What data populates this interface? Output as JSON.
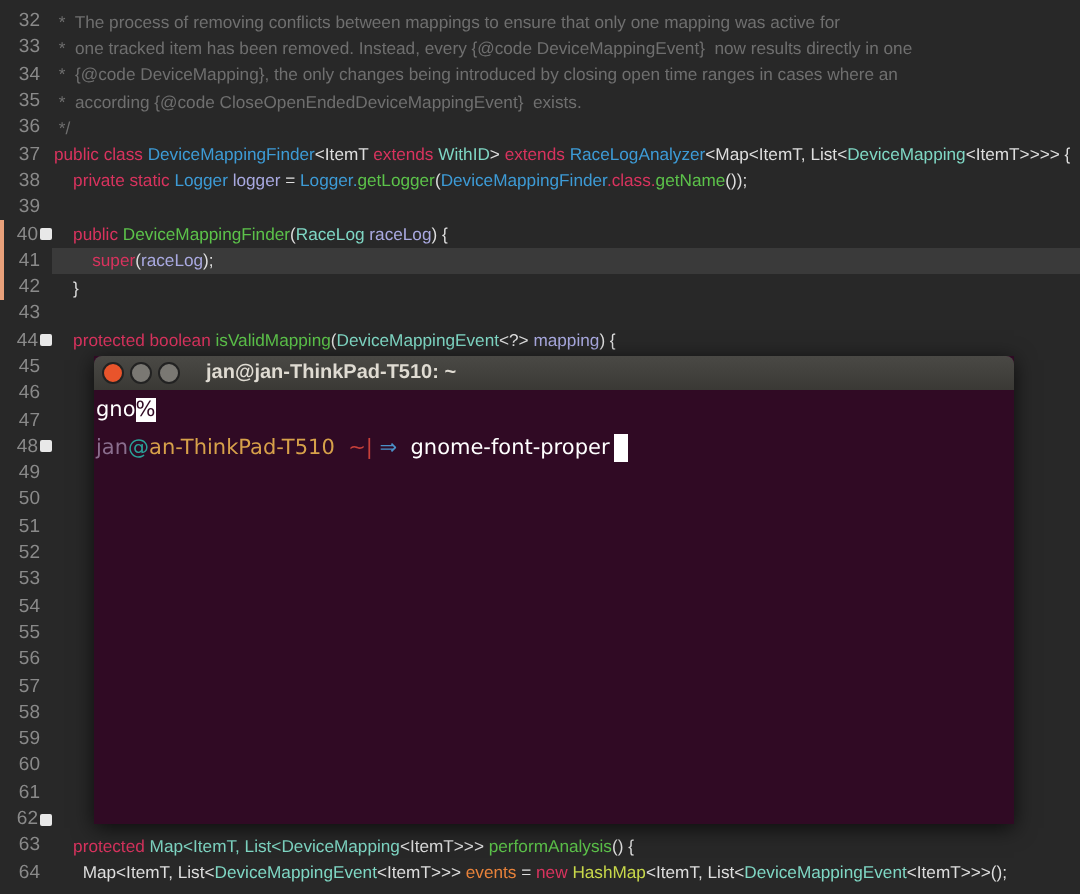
{
  "editor": {
    "lines": [
      {
        "number": "32",
        "fold": false,
        "modified": false,
        "current": false,
        "tokens": [
          {
            "text": " *  The process of removing conflicts between mappings to ensure that only one mapping was active for",
            "kind": "comment"
          }
        ]
      },
      {
        "number": "33",
        "fold": false,
        "modified": false,
        "current": false,
        "tokens": [
          {
            "text": " *  one tracked item has been removed. Instead, every {@code DeviceMappingEvent}  now results directly in one",
            "kind": "comment"
          }
        ]
      },
      {
        "number": "34",
        "fold": false,
        "modified": false,
        "current": false,
        "tokens": [
          {
            "text": " *  {@code DeviceMapping}, the only changes being introduced by closing open time ranges in cases where an",
            "kind": "comment"
          }
        ]
      },
      {
        "number": "35",
        "fold": false,
        "modified": false,
        "current": false,
        "tokens": [
          {
            "text": " *  according {@code CloseOpenEndedDeviceMappingEvent}  exists.",
            "kind": "comment"
          }
        ]
      },
      {
        "number": "36",
        "fold": false,
        "modified": false,
        "current": false,
        "tokens": [
          {
            "text": " */",
            "kind": "comment"
          }
        ]
      },
      {
        "number": "37",
        "fold": false,
        "modified": false,
        "current": false,
        "tokens": [
          {
            "text": "public class ",
            "kind": "keyword"
          },
          {
            "text": "DeviceMappingFinder",
            "kind": "type"
          },
          {
            "text": "<ItemT ",
            "kind": "plain"
          },
          {
            "text": "extends ",
            "kind": "keyword"
          },
          {
            "text": "WithID",
            "kind": "name"
          },
          {
            "text": "> ",
            "kind": "plain"
          },
          {
            "text": "extends ",
            "kind": "keyword"
          },
          {
            "text": "RaceLogAnalyzer",
            "kind": "type"
          },
          {
            "text": "<Map<ItemT, List<",
            "kind": "plain"
          },
          {
            "text": "DeviceMapping",
            "kind": "name"
          },
          {
            "text": "<ItemT>>>> {",
            "kind": "plain"
          }
        ]
      },
      {
        "number": "38",
        "fold": false,
        "modified": false,
        "current": false,
        "tokens": [
          {
            "text": "    private static ",
            "kind": "keyword"
          },
          {
            "text": "Logger ",
            "kind": "type"
          },
          {
            "text": "logger",
            "kind": "param"
          },
          {
            "text": " = ",
            "kind": "plain"
          },
          {
            "text": "Logger.",
            "kind": "type"
          },
          {
            "text": "getLogger",
            "kind": "method"
          },
          {
            "text": "(",
            "kind": "plain"
          },
          {
            "text": "DeviceMappingFinder",
            "kind": "type"
          },
          {
            "text": ".class.",
            "kind": "keyword"
          },
          {
            "text": "getName",
            "kind": "method"
          },
          {
            "text": "());",
            "kind": "plain"
          }
        ]
      },
      {
        "number": "39",
        "fold": false,
        "modified": false,
        "current": false
      },
      {
        "number": "40",
        "fold": true,
        "modified": true,
        "current": false,
        "tokens": [
          {
            "text": "    public ",
            "kind": "keyword"
          },
          {
            "text": "DeviceMappingFinder",
            "kind": "method"
          },
          {
            "text": "(",
            "kind": "plain"
          },
          {
            "text": "RaceLog ",
            "kind": "name"
          },
          {
            "text": "raceLog",
            "kind": "param"
          },
          {
            "text": ") {",
            "kind": "plain"
          }
        ]
      },
      {
        "number": "41",
        "fold": false,
        "modified": true,
        "current": true,
        "tokens": [
          {
            "text": "        super",
            "kind": "keyword"
          },
          {
            "text": "(",
            "kind": "plain"
          },
          {
            "text": "raceLog",
            "kind": "param"
          },
          {
            "text": ");",
            "kind": "plain"
          }
        ]
      },
      {
        "number": "42",
        "fold": false,
        "modified": true,
        "current": false,
        "tokens": [
          {
            "text": "    }",
            "kind": "plain"
          }
        ]
      },
      {
        "number": "43",
        "fold": false,
        "modified": false,
        "current": false
      },
      {
        "number": "44",
        "fold": true,
        "modified": false,
        "current": false,
        "tokens": [
          {
            "text": "    protected boolean ",
            "kind": "keyword"
          },
          {
            "text": "isValidMapping",
            "kind": "method"
          },
          {
            "text": "(",
            "kind": "plain"
          },
          {
            "text": "DeviceMappingEvent",
            "kind": "name"
          },
          {
            "text": "<?> ",
            "kind": "plain"
          },
          {
            "text": "mapping",
            "kind": "param"
          },
          {
            "text": ") {",
            "kind": "plain"
          }
        ]
      },
      {
        "number": "45",
        "fold": false,
        "modified": false,
        "current": false
      },
      {
        "number": "46",
        "fold": false,
        "modified": false,
        "current": false
      },
      {
        "number": "47",
        "fold": false,
        "modified": false,
        "current": false
      },
      {
        "number": "48",
        "fold": true,
        "modified": false,
        "current": false
      },
      {
        "number": "49",
        "fold": false,
        "modified": false,
        "current": false
      },
      {
        "number": "50",
        "fold": false,
        "modified": false,
        "current": false
      },
      {
        "number": "51",
        "fold": false,
        "modified": false,
        "current": false
      },
      {
        "number": "52",
        "fold": false,
        "modified": false,
        "current": false
      },
      {
        "number": "53",
        "fold": false,
        "modified": false,
        "current": false
      },
      {
        "number": "54",
        "fold": false,
        "modified": false,
        "current": false
      },
      {
        "number": "55",
        "fold": false,
        "modified": false,
        "current": false
      },
      {
        "number": "56",
        "fold": false,
        "modified": false,
        "current": false
      },
      {
        "number": "57",
        "fold": false,
        "modified": false,
        "current": false
      },
      {
        "number": "58",
        "fold": false,
        "modified": false,
        "current": false
      },
      {
        "number": "59",
        "fold": false,
        "modified": false,
        "current": false
      },
      {
        "number": "60",
        "fold": false,
        "modified": false,
        "current": false
      },
      {
        "number": "61",
        "fold": false,
        "modified": false,
        "current": false
      },
      {
        "number": "62",
        "fold": true,
        "modified": false,
        "current": false
      },
      {
        "number": "63",
        "fold": false,
        "modified": false,
        "current": false,
        "tokens": [
          {
            "text": "    protected ",
            "kind": "keyword"
          },
          {
            "text": "Map<ItemT, List<",
            "kind": "name"
          },
          {
            "text": "DeviceMapping",
            "kind": "name"
          },
          {
            "text": "<ItemT>>> ",
            "kind": "plain"
          },
          {
            "text": "performAnalysis",
            "kind": "method"
          },
          {
            "text": "() {",
            "kind": "plain"
          }
        ]
      },
      {
        "number": "64",
        "fold": false,
        "modified": false,
        "current": false,
        "tokens": [
          {
            "text": "      Map<ItemT, List<",
            "kind": "plain"
          },
          {
            "text": "DeviceMappingEvent",
            "kind": "name"
          },
          {
            "text": "<ItemT>>> ",
            "kind": "plain"
          },
          {
            "text": "events",
            "kind": "field"
          },
          {
            "text": " = ",
            "kind": "plain"
          },
          {
            "text": "new ",
            "kind": "keyword"
          },
          {
            "text": "HashMap",
            "kind": "class"
          },
          {
            "text": "<ItemT, List<",
            "kind": "plain"
          },
          {
            "text": "DeviceMappingEvent",
            "kind": "name"
          },
          {
            "text": "<ItemT>>>();",
            "kind": "plain"
          }
        ]
      }
    ]
  },
  "terminal": {
    "title": "jan@jan-ThinkPad-T510: ~",
    "lines": [
      [
        {
          "text": "gno",
          "kind": "plain"
        },
        {
          "text": "%",
          "kind": "inverse"
        }
      ],
      [
        {
          "text": "jan",
          "kind": "user"
        },
        {
          "text": "@",
          "kind": "at"
        },
        {
          "text": "an-ThinkPad-T510",
          "kind": "host"
        },
        {
          "text": "  ~",
          "kind": "dir"
        },
        {
          "text": "|",
          "kind": "sep"
        },
        {
          "text": " ⇒ ",
          "kind": "arrow"
        },
        {
          "text": " gnome-font-proper",
          "kind": "plain"
        },
        {
          "kind": "cursor"
        }
      ]
    ]
  }
}
